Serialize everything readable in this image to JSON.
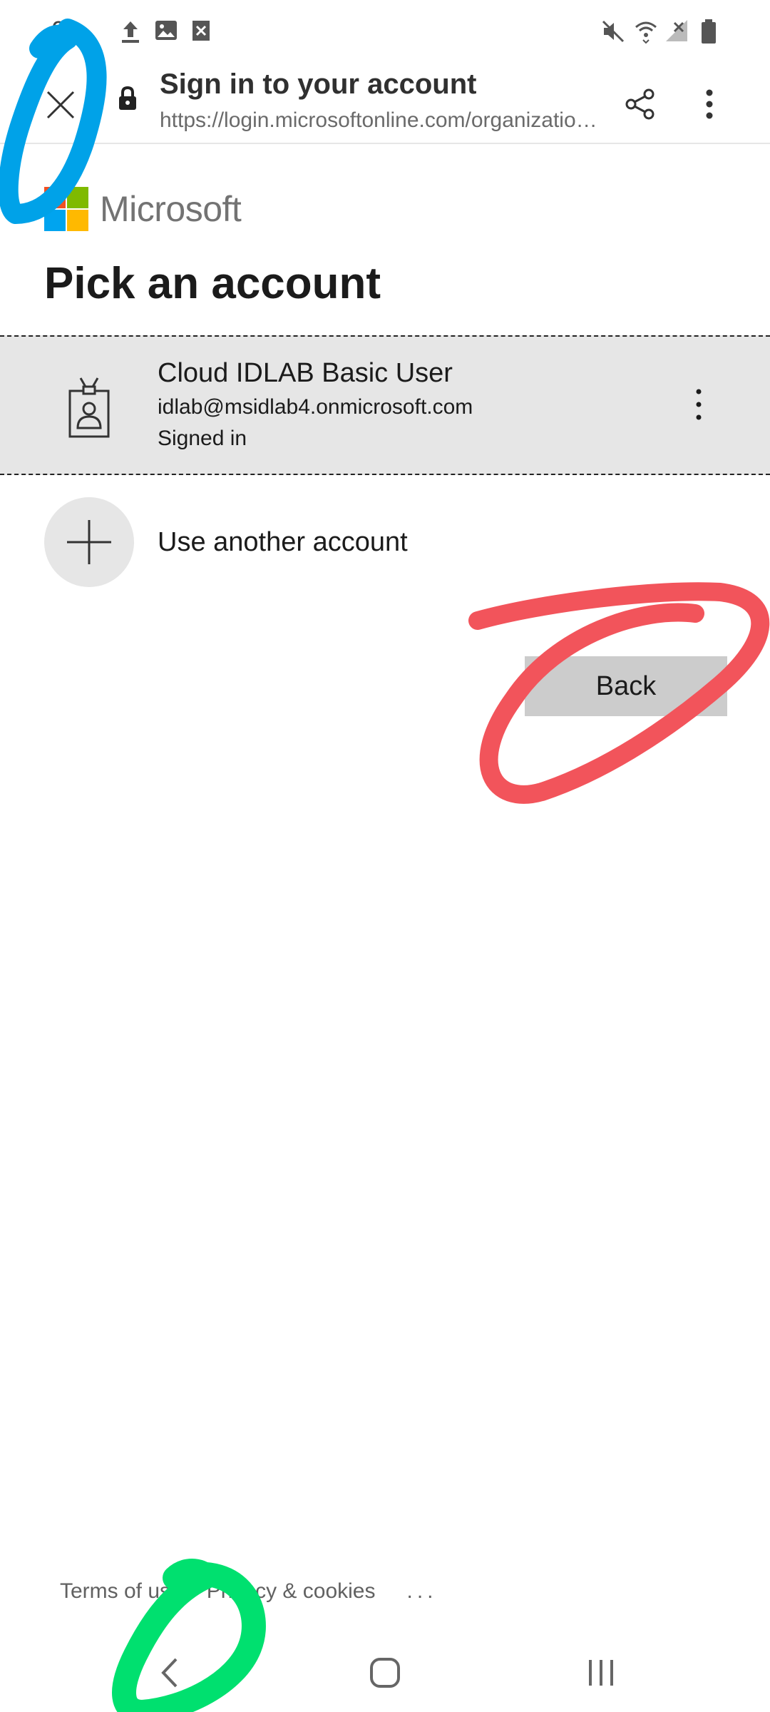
{
  "status_bar": {
    "time": "06",
    "icons": [
      "upload-icon",
      "image-icon",
      "close-box-icon",
      "mute-icon",
      "wifi-icon",
      "signal-icon",
      "battery-icon"
    ]
  },
  "browser": {
    "title": "Sign in to your account",
    "url": "https://login.microsoftonline.com/organizatio…"
  },
  "brand": {
    "name": "Microsoft",
    "colors": {
      "red": "#f25022",
      "green": "#7fba00",
      "blue": "#00a4ef",
      "yellow": "#ffb900"
    }
  },
  "main": {
    "heading": "Pick an account",
    "accounts": [
      {
        "name": "Cloud IDLAB Basic User",
        "email": "idlab@msidlab4.onmicrosoft.com",
        "status": "Signed in"
      }
    ],
    "use_another_label": "Use another account",
    "back_label": "Back"
  },
  "footer": {
    "terms": "Terms of use",
    "privacy": "Privacy & cookies",
    "more": "..."
  },
  "annotations": {
    "colors": {
      "blue": "#00a2e8",
      "red": "#f2545b",
      "green": "#00e06f"
    }
  }
}
